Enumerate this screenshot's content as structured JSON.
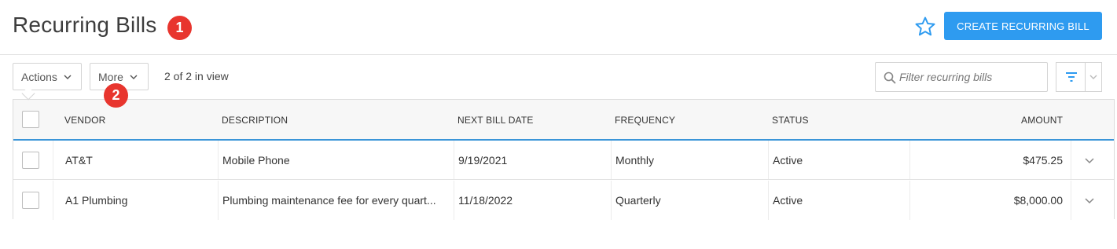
{
  "header": {
    "title": "Recurring Bills",
    "create_button_label": "CREATE RECURRING BILL",
    "star_icon": "star-outline-icon",
    "accent_color": "#2e9bf0",
    "marker_color": "#e8352e"
  },
  "markers": [
    "1",
    "2"
  ],
  "toolbar": {
    "actions_label": "Actions",
    "more_label": "More",
    "count_text": "2 of 2 in view",
    "search_placeholder": "Filter recurring bills",
    "filter_icon": "filter-icon"
  },
  "table": {
    "columns": [
      "VENDOR",
      "DESCRIPTION",
      "NEXT BILL DATE",
      "FREQUENCY",
      "STATUS",
      "AMOUNT"
    ],
    "rows": [
      {
        "vendor": "AT&T",
        "description": "Mobile Phone",
        "next_bill_date": "9/19/2021",
        "frequency": "Monthly",
        "status": "Active",
        "amount": "$475.25"
      },
      {
        "vendor": "A1 Plumbing",
        "description": "Plumbing maintenance fee for every quart...",
        "next_bill_date": "11/18/2022",
        "frequency": "Quarterly",
        "status": "Active",
        "amount": "$8,000.00"
      }
    ]
  }
}
